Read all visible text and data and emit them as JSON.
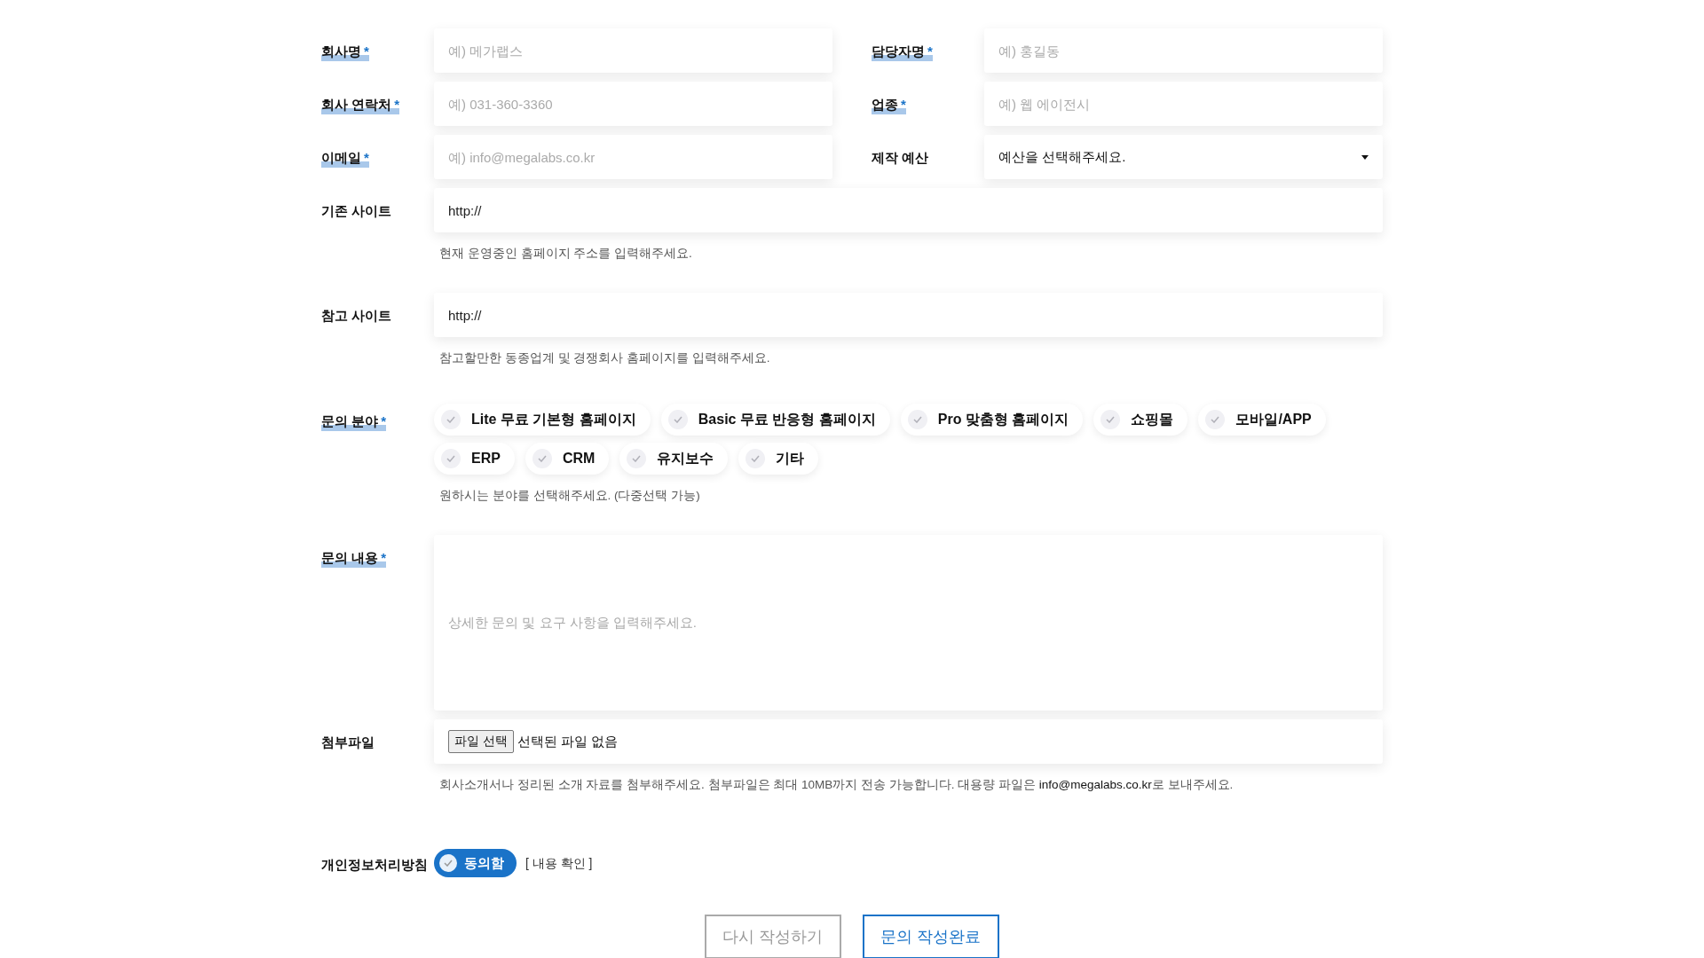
{
  "paired_rows": [
    [
      {
        "label": "회사명",
        "required_mark": "*",
        "kind": "input",
        "placeholder": "예) 메가랩스"
      },
      {
        "label": "담당자명",
        "required_mark": "*",
        "kind": "input",
        "placeholder": "예) 홍길동"
      }
    ],
    [
      {
        "label": "회사 연락처",
        "required_mark": "*",
        "kind": "input",
        "placeholder": "예) 031-360-3360"
      },
      {
        "label": "업종",
        "required_mark": "*",
        "kind": "input",
        "placeholder": "예) 웹 에이전시"
      }
    ],
    [
      {
        "label": "이메일",
        "required_mark": "*",
        "kind": "input",
        "placeholder": "예) info@megalabs.co.kr"
      },
      {
        "label": "제작 예산",
        "kind": "select",
        "value": "예산을 선택해주세요."
      }
    ]
  ],
  "wide_rows": [
    {
      "label": "기존 사이트",
      "kind": "input",
      "value": "http://",
      "hint": "현재 운영중인 홈페이지 주소를 입력해주세요."
    },
    {
      "label": "참고 사이트",
      "kind": "input",
      "value": "http://",
      "hint": "참고할만한 동종업계 및 경쟁회사 홈페이지를 입력해주세요."
    },
    {
      "label": "문의 분야",
      "required_mark": "*",
      "kind": "chips",
      "options": [
        {
          "label": "Lite 무료 기본형 홈페이지",
          "selected": false
        },
        {
          "label": "Basic 무료 반응형 홈페이지",
          "selected": false
        },
        {
          "label": "Pro 맞춤형 홈페이지",
          "selected": false
        },
        {
          "label": "쇼핑몰",
          "selected": false
        },
        {
          "label": "모바일/APP",
          "selected": false
        },
        {
          "label": "ERP",
          "selected": false
        },
        {
          "label": "CRM",
          "selected": false
        },
        {
          "label": "유지보수",
          "selected": false
        },
        {
          "label": "기타",
          "selected": false
        }
      ],
      "hint": "원하시는 분야를 선택해주세요. (다중선택 가능)"
    },
    {
      "label": "문의 내용",
      "required_mark": "*",
      "kind": "textarea",
      "placeholder": "상세한 문의 및 요구 사항을 입력해주세요."
    },
    {
      "label": "첨부파일",
      "kind": "file",
      "button": "파일 선택",
      "status": "선택된 파일 없음",
      "hint": "회사소개서나 정리된 소개 자료를 첨부해주세요. 첨부파일은 최대 10MB까지 전송 가능합니다. 대용량 파일은 **info@megalabs.co.kr**로 보내주세요."
    },
    {
      "label": "개인정보처리방침",
      "kind": "consent",
      "toggle": "동의함",
      "checked": true,
      "link": "[ 내용 확인 ]"
    }
  ],
  "buttons": [
    {
      "label": "다시 작성하기",
      "kind": "secondary"
    },
    {
      "label": "문의 작성완료",
      "kind": "primary"
    }
  ]
}
